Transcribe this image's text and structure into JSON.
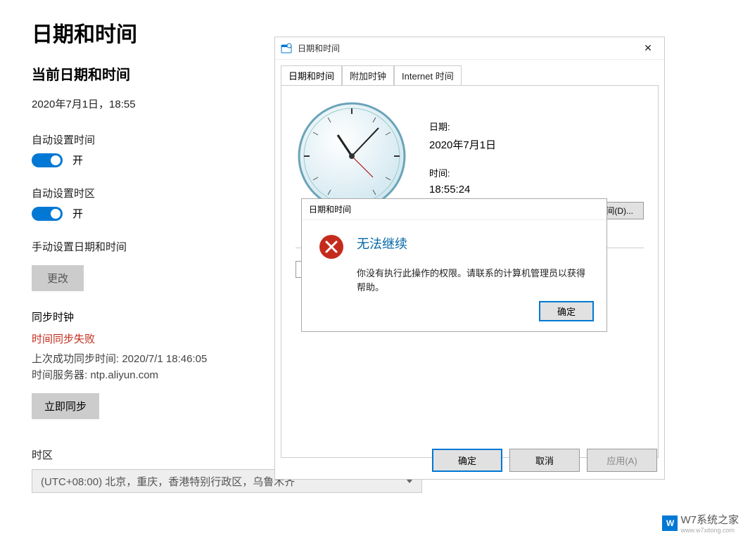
{
  "page": {
    "title": "日期和时间",
    "section_current": "当前日期和时间",
    "datetime": "2020年7月1日，18:55",
    "auto_time_label": "自动设置时间",
    "auto_tz_label": "自动设置时区",
    "toggle_on": "开",
    "manual_label": "手动设置日期和时间",
    "change_btn": "更改",
    "sync_heading": "同步时钟",
    "sync_fail": "时间同步失败",
    "sync_last": "上次成功同步时间: 2020/7/1 18:46:05",
    "sync_server": "时间服务器: ntp.aliyun.com",
    "sync_now": "立即同步",
    "tz_heading": "时区",
    "tz_value": "(UTC+08:00) 北京，重庆，香港特别行政区，乌鲁木齐"
  },
  "dialog": {
    "title": "日期和时间",
    "tabs": [
      "日期和时间",
      "附加时钟",
      "Internet 时间"
    ],
    "date_label": "日期:",
    "date_value": "2020年7月1日",
    "time_label": "时间:",
    "time_value": "18:55:24",
    "change_dt": "间(D)...",
    "tz_field": "",
    "ok": "确定",
    "cancel": "取消",
    "apply": "应用(A)"
  },
  "error": {
    "title": "日期和时间",
    "heading": "无法继续",
    "body": "你没有执行此操作的权限。请联系的计算机管理员以获得帮助。",
    "ok": "确定"
  },
  "watermark": {
    "text": "W7系统之家",
    "sub": "www.w7xitong.com"
  }
}
